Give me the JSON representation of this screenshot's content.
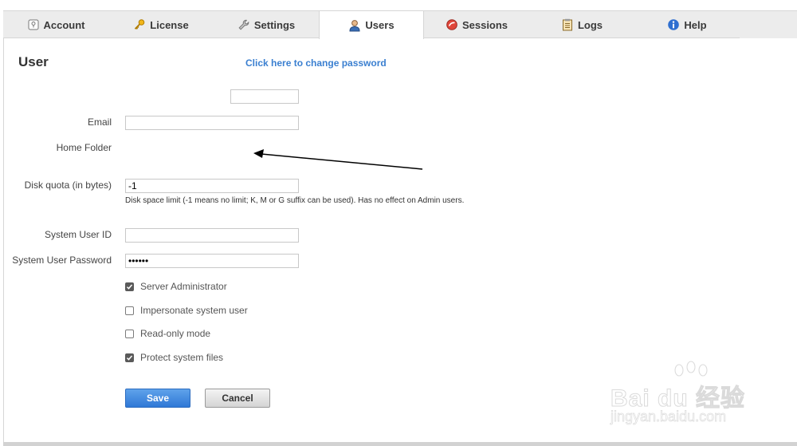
{
  "tabs": [
    {
      "label": "Account",
      "icon": "account-icon",
      "active": false
    },
    {
      "label": "License",
      "icon": "key-icon",
      "active": false
    },
    {
      "label": "Settings",
      "icon": "wrench-icon",
      "active": false
    },
    {
      "label": "Users",
      "icon": "user-icon",
      "active": true
    },
    {
      "label": "Sessions",
      "icon": "sessions-icon",
      "active": false
    },
    {
      "label": "Logs",
      "icon": "logs-icon",
      "active": false
    },
    {
      "label": "Help",
      "icon": "help-icon",
      "active": false
    }
  ],
  "page": {
    "title": "User",
    "change_password_link": "Click here to change password"
  },
  "form": {
    "username_value": "",
    "email_label": "Email",
    "email_value": "",
    "home_folder_label": "Home Folder",
    "disk_quota_label": "Disk quota (in bytes)",
    "disk_quota_value": "-1",
    "disk_quota_hint": "Disk space limit (-1 means no limit; K, M or G suffix can be used). Has no effect on Admin users.",
    "system_user_id_label": "System User ID",
    "system_user_id_value": "",
    "system_user_password_label": "System User Password",
    "system_user_password_value": "••••••"
  },
  "checkboxes": [
    {
      "label": "Server Administrator",
      "checked": true
    },
    {
      "label": "Impersonate system user",
      "checked": false
    },
    {
      "label": "Read-only mode",
      "checked": false
    },
    {
      "label": "Protect system files",
      "checked": true
    }
  ],
  "buttons": {
    "save": "Save",
    "cancel": "Cancel"
  },
  "watermark": {
    "brand": "Bai du 经验",
    "sub": "jingyan.baidu.com"
  },
  "colors": {
    "accent": "#3a7fd0",
    "save_button": "#2f78d6"
  }
}
